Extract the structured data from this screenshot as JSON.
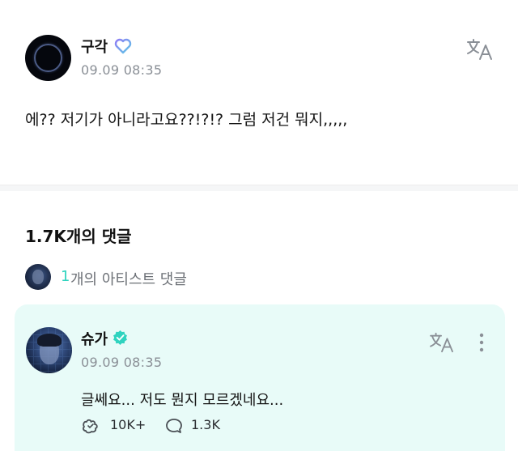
{
  "post": {
    "author": "구각",
    "timestamp": "09.09 08:35",
    "text": "에?? 저기가 아니라고요??!?!? 그럼 저건 뭐지,,,,,",
    "author_badge_icon": "heart-outline-icon",
    "translate_icon": "translate-icon"
  },
  "comments": {
    "title": "1.7K개의 댓글",
    "artist_comment_count": "1",
    "artist_comment_label": "개의 아티스트 댓글"
  },
  "artist_comment": {
    "author": "슈가",
    "timestamp": "09.09 08:35",
    "text": "글쎄요... 저도 뭔지 모르겠네요...",
    "likes": "10K+",
    "replies": "1.3K",
    "verified_icon": "verified-check-icon",
    "card_color": "#e8fbf8",
    "accent_color": "#2fd3bf"
  }
}
